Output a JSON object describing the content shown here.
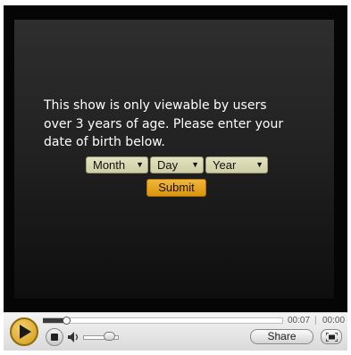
{
  "message": {
    "line1": "This show is only viewable by users",
    "line2": "over 3 years of age. Please enter your",
    "line3": "date of birth below."
  },
  "dob_form": {
    "month": "Month",
    "day": "Day",
    "year": "Year",
    "submit_label": "Submit"
  },
  "controls": {
    "current_time": "00:07",
    "separator": "|",
    "duration": "00:00",
    "share_label": "Share",
    "progress": 0.1,
    "volume": 0.7
  },
  "icons": [
    "play-icon",
    "stop-icon",
    "speaker-icon",
    "fullscreen-icon",
    "dropdown-arrow-icon"
  ],
  "colors": {
    "accent": "#e0a321",
    "select_bg": "#d9d9b1",
    "video_bg": "#1c1c1c"
  }
}
